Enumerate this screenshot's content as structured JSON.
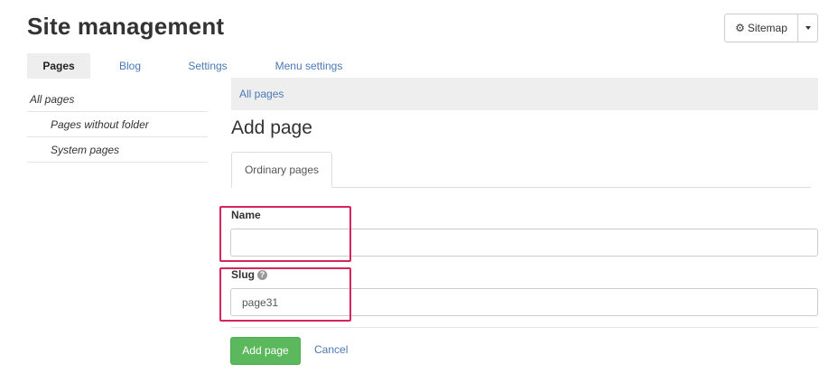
{
  "header": {
    "title": "Site management",
    "sitemap_label": "Sitemap"
  },
  "top_tabs": [
    {
      "label": "Pages",
      "active": true
    },
    {
      "label": "Blog",
      "active": false
    },
    {
      "label": "Settings",
      "active": false
    },
    {
      "label": "Menu settings",
      "active": false
    }
  ],
  "sidebar": {
    "items": [
      {
        "label": "All pages"
      },
      {
        "label": "Pages without folder"
      },
      {
        "label": "System pages"
      }
    ]
  },
  "breadcrumb": {
    "label": "All pages"
  },
  "section_title": "Add page",
  "form_tabs": [
    {
      "label": "Ordinary pages"
    }
  ],
  "form": {
    "name_label": "Name",
    "name_value": "",
    "slug_label": "Slug",
    "slug_help": "?",
    "slug_value": "page31"
  },
  "actions": {
    "submit_label": "Add page",
    "cancel_label": "Cancel"
  },
  "colors": {
    "link": "#4a79b5",
    "primary_green": "#5cb85c",
    "highlight": "#d6255c",
    "tab_bg": "#eeeeee"
  },
  "icons": {
    "sitemap": "gear-icon",
    "dropdown": "caret-down-icon",
    "slug_help": "help-icon"
  }
}
